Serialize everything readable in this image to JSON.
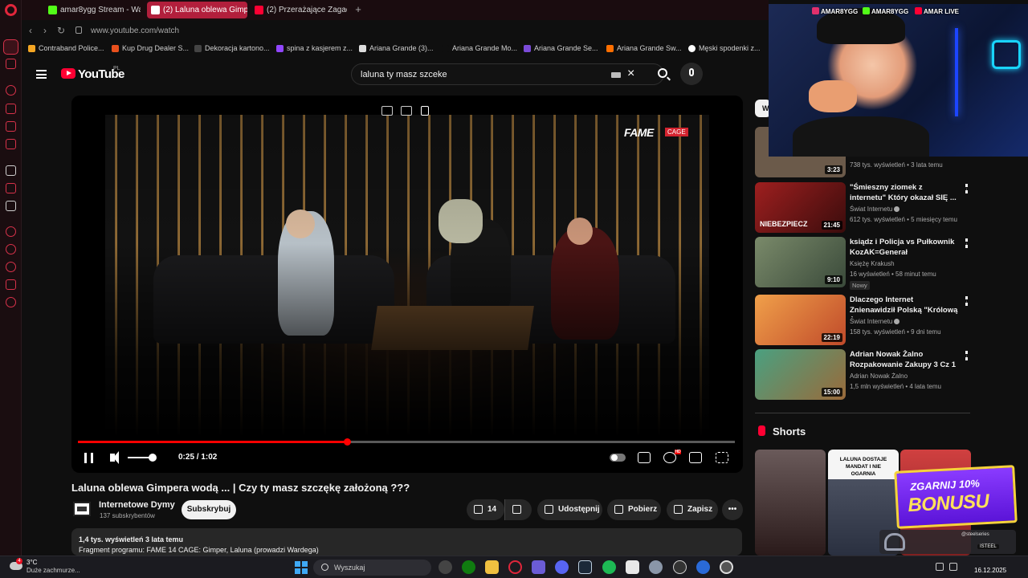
{
  "browser": {
    "tabs": [
      {
        "label": "amar8ygg Stream - Watch",
        "favicon_color": "#53fc18",
        "active": false
      },
      {
        "label": "(2) Laluna oblewa Gimpera",
        "favicon_color": "#ffffff",
        "active": true
      },
      {
        "label": "(2) Przerażające Zagadki",
        "favicon_color": "#ff0033",
        "active": false
      }
    ],
    "url": "www.youtube.com/watch",
    "bookmarks": [
      {
        "label": "Contraband Police...",
        "color": "#f5a623"
      },
      {
        "label": "Kup Drug Dealer S...",
        "color": "#e8501d"
      },
      {
        "label": "Dekoracja kartono...",
        "color": "#444444"
      },
      {
        "label": "spina z kasjerem z...",
        "color": "#9146ff"
      },
      {
        "label": "Ariana Grande (3)...",
        "color": "#dddddd"
      },
      {
        "label": "Ariana Grande Mo...",
        "color": "#0f0f0f"
      },
      {
        "label": "Ariana Grande Se...",
        "color": "#7b4bd8"
      },
      {
        "label": "Ariana Grande Sw...",
        "color": "#ff6f00"
      },
      {
        "label": "Męski spodenki z...",
        "color": "#ffffff"
      }
    ]
  },
  "youtube": {
    "logo_text": "YouTube",
    "country": "PL",
    "search_query": "laluna ty masz szceke",
    "video": {
      "overlay_brand": "FAME",
      "overlay_sub": "CAGE",
      "time_current": "0:25",
      "time_total": "1:02",
      "time_display": "0:25 / 1:02",
      "progress": 0.41,
      "volume": 0.8
    },
    "title": "Laluna oblewa Gimpera wodą ... | Czy ty masz szczękę założoną ???",
    "channel": {
      "name": "Internetowe Dymy",
      "subscribers": "137 subskrybentów",
      "subscribe_label": "Subskrybuj"
    },
    "actions": {
      "likes": "14",
      "share": "Udostępnij",
      "download": "Pobierz",
      "save": "Zapisz"
    },
    "description": {
      "stats": "1,4 tys. wyświetleń  3 lata temu",
      "text": "Fragment programu: FAME 14 CAGE: Gimper, Laluna (prowadzi Wardega)"
    },
    "recommendations": [
      {
        "title": "",
        "channel": "",
        "meta": "738 tys. wyświetleń • 3 lata temu",
        "duration": "3:23",
        "thumb_color": "#6b5a4a",
        "badge": ""
      },
      {
        "title": "\"Śmieszny ziomek z internetu\" Który okazał SIĘ ...",
        "channel": "Świat Internetu",
        "meta": "612 tys. wyświetleń • 5 miesięcy temu",
        "duration": "21:45",
        "thumb_color": "#8c1c1c",
        "badge": "",
        "thumb_text": "NIEBEZPIECZ"
      },
      {
        "title": "ksiądz i Policja vs Pułkownik KozAK=Generał Asperger=ppł...",
        "channel": "Księżę Krakush",
        "meta": "16 wyświetleń • 58 minut temu",
        "duration": "9:10",
        "thumb_color": "#5a6a4a",
        "badge": "Nowy"
      },
      {
        "title": "Dlaczego Internet Znienawidził Polską \"Królową Życia\"?",
        "channel": "Świat Internetu",
        "meta": "158 tys. wyświetleń • 9 dni temu",
        "duration": "22:19",
        "thumb_color": "#d4663a",
        "badge": ""
      },
      {
        "title": "Adrian Nowak Żalno Rozpakowanie Zakupy 3 Cz 1",
        "channel": "Adrian Nowak Żalno",
        "meta": "1,5 mln wyświetleń • 4 lata temu",
        "duration": "15:00",
        "thumb_color": "#3c8a6a",
        "badge": ""
      }
    ],
    "shorts_label": "Shorts",
    "shorts": [
      {
        "thumb_color": "#5a4a4a",
        "caption": ""
      },
      {
        "thumb_color": "#3a4050",
        "caption": "LALUNA DOSTAJE MANDAT I NIE OGARNIA"
      },
      {
        "thumb_color": "#c03a3a",
        "caption": ""
      }
    ]
  },
  "overlay": {
    "socials": [
      {
        "label": "AMAR8YGG",
        "color": "#e1306c"
      },
      {
        "label": "AMAR8YGG",
        "color": "#53fc18"
      },
      {
        "label": "AMAR LIVE",
        "color": "#ff0033"
      }
    ],
    "bonus_top": "ZGARNIJ 10%",
    "bonus_big": "BONUSU",
    "sponsor_brand": "@steelseries",
    "sponsor_tag": "ISTEEL"
  },
  "taskbar": {
    "weather_temp": "3°C",
    "weather_desc": "Duże zachmurze...",
    "weather_badge": "4",
    "search_placeholder": "Wyszukaj",
    "date": "16.12.2025"
  }
}
